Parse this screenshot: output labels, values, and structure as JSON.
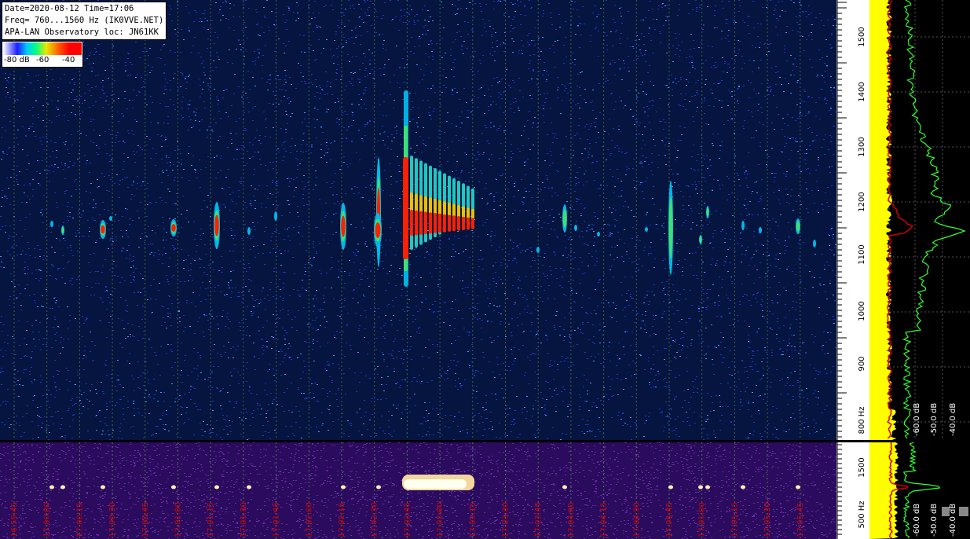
{
  "header": {
    "line1": "Date=2020-08-12 Time=17:06",
    "line2": "Freq= 760...1560 Hz (IK0VVE.NET)",
    "line3": "APA-LAN Observatory loc: JN61KK"
  },
  "color_scale": {
    "label_low": "-80 dB",
    "label_mid": "-60",
    "label_high": "-40"
  },
  "freq_axis": {
    "ticks": [
      "1500",
      "1400",
      "1300",
      "1200",
      "1100",
      "1000",
      "900",
      "800 Hz"
    ]
  },
  "level_axis": {
    "ticks": [
      "-60.0 dB",
      "-50.0 dB",
      "-40.0 dB"
    ]
  },
  "overview_freq_axis": {
    "ticks": [
      "1500",
      "500 Hz"
    ]
  },
  "overview_level_axis": {
    "ticks": [
      "-60.0 dB",
      "-50.0 dB",
      "-40.0 dB"
    ]
  },
  "time_axis": {
    "labels": [
      "16:59:45",
      "17:00:00",
      "17:00:15",
      "17:00:30",
      "17:00:45",
      "17:01:00",
      "17:01:15",
      "17:01:30",
      "17:01:45",
      "17:02:00",
      "17:02:15",
      "17:02:30",
      "17:02:45",
      "17:03:00",
      "17:03:15",
      "17:03:30",
      "17:03:45",
      "17:04:00",
      "17:04:15",
      "17:04:30",
      "17:04:45",
      "17:05:00",
      "17:05:15",
      "17:05:30",
      "17:05:45"
    ]
  },
  "colors": {
    "waterfall_bg": "#061440",
    "overview_bg": "#2a0b5e",
    "spectrum_yellow": "#ffff00",
    "trace_green": "#33ff33",
    "trace_red": "#cc0000",
    "time_label": "#d40000"
  }
}
